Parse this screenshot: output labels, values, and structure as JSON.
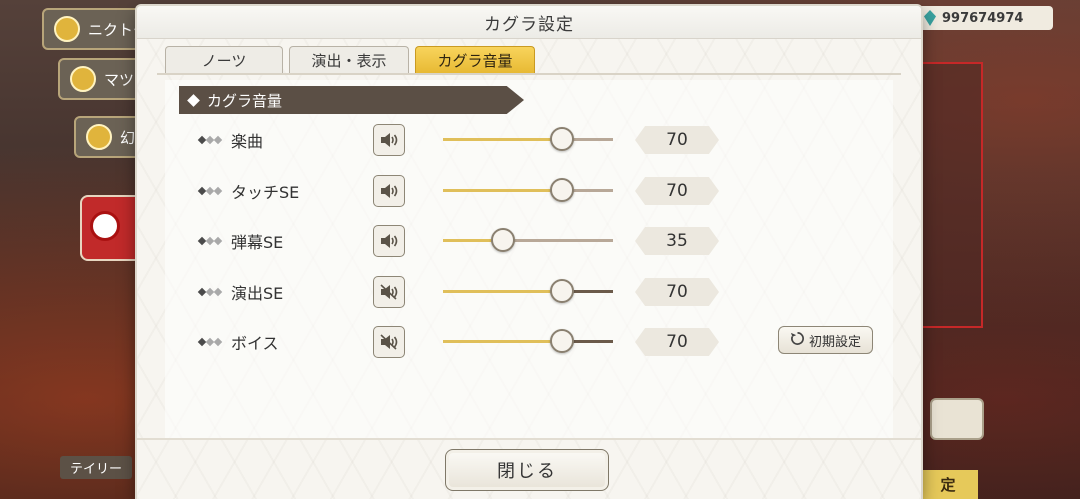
{
  "background": {
    "cards": [
      "ニクトー",
      "マツ",
      "幻"
    ],
    "currency": "997674974",
    "bottom_left_label": "テイリー",
    "bottom_right_label": "定"
  },
  "dialog": {
    "title": "カグラ設定",
    "tabs": [
      {
        "label": "ノーツ",
        "active": false
      },
      {
        "label": "演出・表示",
        "active": false
      },
      {
        "label": "カグラ音量",
        "active": true
      }
    ],
    "section_title": "カグラ音量",
    "volume_rows": [
      {
        "label": "楽曲",
        "value": "70",
        "level": 70,
        "speaker": "speaker-on-icon"
      },
      {
        "label": "タッチSE",
        "value": "70",
        "level": 70,
        "speaker": "speaker-on-icon"
      },
      {
        "label": "弾幕SE",
        "value": "35",
        "level": 35,
        "speaker": "speaker-on-icon"
      },
      {
        "label": "演出SE",
        "value": "70",
        "level": 70,
        "speaker": "speaker-muted-icon"
      },
      {
        "label": "ボイス",
        "value": "70",
        "level": 70,
        "speaker": "speaker-muted-icon"
      }
    ],
    "reset_label": "初期設定",
    "close_label": "閉じる"
  },
  "colors": {
    "accent_tab": "#f0c846",
    "slider_fill": "#e0bf5a",
    "banner": "#5b4f45"
  }
}
